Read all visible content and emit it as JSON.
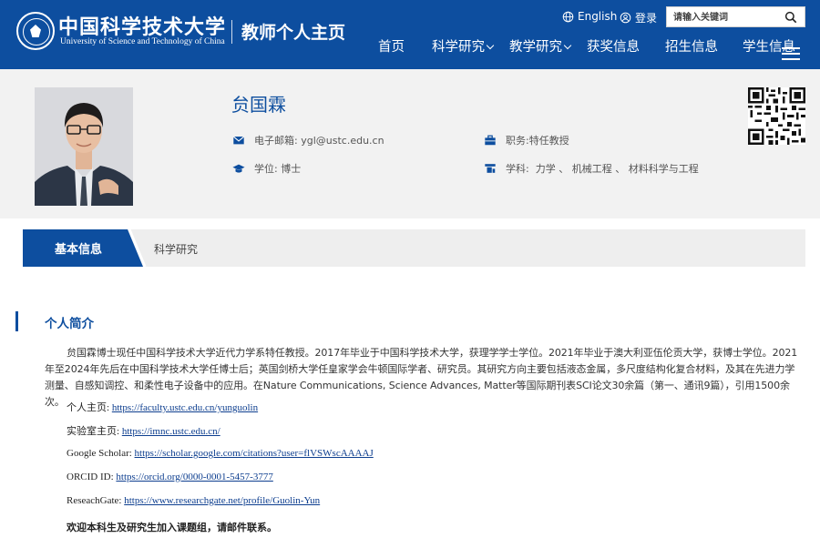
{
  "header": {
    "logo_cn": "中国科学技术大学",
    "logo_en": "University of Science and Technology of China",
    "site_title": "教师个人主页",
    "language_link": "English",
    "login_link": "登录",
    "search_placeholder": "请输入关键词",
    "nav": [
      {
        "label": "首页",
        "has_dropdown": false
      },
      {
        "label": "科学研究",
        "has_dropdown": true
      },
      {
        "label": "教学研究",
        "has_dropdown": true
      },
      {
        "label": "获奖信息",
        "has_dropdown": false
      },
      {
        "label": "招生信息",
        "has_dropdown": false
      },
      {
        "label": "学生信息",
        "has_dropdown": false
      }
    ]
  },
  "profile": {
    "name": "贠国霖",
    "email_label": "电子邮箱:",
    "email_value": "ygl@ustc.edu.cn",
    "position_label": "职务:",
    "position_value": "特任教授",
    "degree_label": "学位:",
    "degree_value": "博士",
    "discipline_label": "学科:",
    "discipline_value": "力学 、 机械工程 、 材料科学与工程"
  },
  "tabs": [
    {
      "label": "基本信息",
      "active": true
    },
    {
      "label": "科学研究",
      "active": false
    }
  ],
  "content": {
    "section_title": "个人简介",
    "bio": "贠国霖博士现任中国科学技术大学近代力学系特任教授。2017年毕业于中国科学技术大学，获理学学士学位。2021年毕业于澳大利亚伍伦贡大学，获博士学位。2021年至2024年先后在中国科学技术大学任博士后；英国剑桥大学任皇家学会牛顿国际学者、研究员。其研究方向主要包括液态金属，多尺度结构化复合材料，及其在先进力学测量、自感知调控、和柔性电子设备中的应用。在Nature Communications, Science Advances, Matter等国际期刊表SCI论文30余篇（第一、通讯9篇），引用1500余次。",
    "links": [
      {
        "label": "个人主页: ",
        "url": "https://faculty.ustc.edu.cn/yunguolin"
      },
      {
        "label": "实验室主页: ",
        "url": "https://imnc.ustc.edu.cn/"
      },
      {
        "label": "Google Scholar: ",
        "url": "https://scholar.google.com/citations?user=flVSWscAAAAJ"
      },
      {
        "label": "ORCID ID: ",
        "url": "https://orcid.org/0000-0001-5457-3777"
      },
      {
        "label": "ReseachGate: ",
        "url": "https://www.researchgate.net/profile/Guolin-Yun"
      }
    ],
    "welcome": "欢迎本科生及研究生加入课题组，请邮件联系。"
  },
  "colors": {
    "brand_blue": "#0d4e9f",
    "profile_bg": "#f2f2f2",
    "tabbar_bg": "#eeeeee"
  }
}
